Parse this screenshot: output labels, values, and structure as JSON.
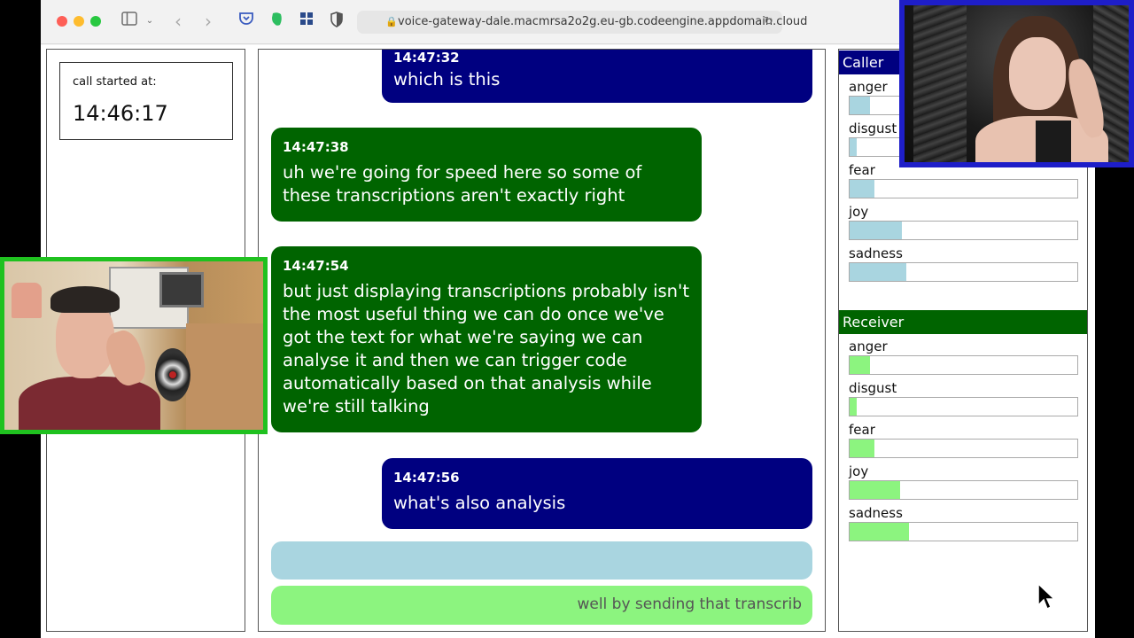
{
  "browser": {
    "url": "voice-gateway-dale.macmrsa2o2g.eu-gb.codeengine.appdomain.cloud"
  },
  "call": {
    "started_label": "call started at:",
    "started_time": "14:46:17"
  },
  "messages": [
    {
      "speaker": "caller",
      "time": "14:47:32",
      "text": "which is this"
    },
    {
      "speaker": "receiver",
      "time": "14:47:38",
      "text": "uh we're going for speed here so some of these transcriptions aren't exactly right"
    },
    {
      "speaker": "receiver",
      "time": "14:47:54",
      "text": "but just displaying transcriptions probably isn't the most useful thing we can do once we've got the text for what we're saying we can analyse it and then we can trigger code automatically based on that analysis while we're still talking"
    },
    {
      "speaker": "caller",
      "time": "14:47:56",
      "text": "what's also analysis"
    }
  ],
  "interim": {
    "caller_text": "",
    "receiver_text": "well by sending that transcrib"
  },
  "emotions": {
    "caller": {
      "title": "Caller",
      "items": [
        {
          "label": "anger",
          "value": 0.09
        },
        {
          "label": "disgust",
          "value": 0.03
        },
        {
          "label": "fear",
          "value": 0.11
        },
        {
          "label": "joy",
          "value": 0.23
        },
        {
          "label": "sadness",
          "value": 0.25
        }
      ]
    },
    "receiver": {
      "title": "Receiver",
      "items": [
        {
          "label": "anger",
          "value": 0.09
        },
        {
          "label": "disgust",
          "value": 0.03
        },
        {
          "label": "fear",
          "value": 0.11
        },
        {
          "label": "joy",
          "value": 0.22
        },
        {
          "label": "sadness",
          "value": 0.26
        }
      ]
    }
  },
  "colors": {
    "caller": "#000080",
    "receiver": "#006400",
    "caller_bar": "#a9d5e0",
    "receiver_bar": "#8cf47f"
  }
}
